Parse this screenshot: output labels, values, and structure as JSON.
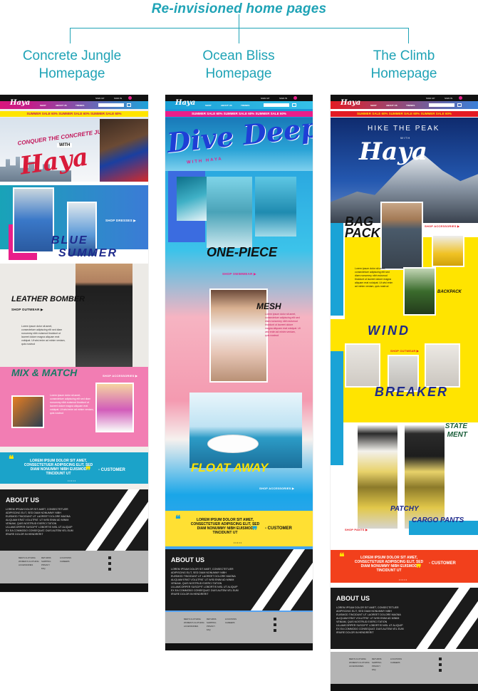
{
  "heading": "Re-invisioned home pages",
  "columns": [
    {
      "title_line1": "Concrete Jungle",
      "title_line2": "Homepage"
    },
    {
      "title_line1": "Ocean Bliss",
      "title_line2": "Homepage"
    },
    {
      "title_line1": "The Climb",
      "title_line2": "Homepage"
    }
  ],
  "common": {
    "brand": "Haya",
    "sign_up": "SIGN UP",
    "sign_in": "SIGN IN",
    "nav": [
      "SHOP",
      "ABOUT US",
      "TRENDS"
    ],
    "sale": "SUMMER SALE 60% SUMMER SALE 60% SUMMER SALE 60%",
    "quote": "LOREM IPSUM DOLOR SIT AMET, CONSECTETUER ADIPISCING ELIT, SED DIAM NONUMMY NIBH EUISMOD TINCIDUNT UT",
    "customer": "- CUSTOMER",
    "about_title": "ABOUT US",
    "about_text": "LOREM IPSUM DOLOR SIT AMET, CONSECTETUER ADIPISCING ELIT, SED DIAM NONUMMY NIBH EUISMOD TINCIDUNT UT LAOREET DOLORE MAGNA ALIQUAM ERAT VOLUTPAT. UT WISI ENIM AD MINIM VENIAM, QUIS NOSTRUD EXERCI TATION ULLAMCORPER SUSCIPIT LOBORTIS NISL UT ALIQUIP EX EA COMMODO CONSEQUAT. DUIS AUTEM VEL EUM IRIURE DOLOR IN HENDRERIT",
    "body_text": "Lorem ipsum dolor sit amet, consectetuer adipiscing elit sed diam nonummy nibh euismod tincidunt ut laoreet dolore magna aliquam erat volutpat. Ut wisi enim ad minim veniam, quis nostrud",
    "footer_col1": [
      "MEN'S CLOTHING",
      "WOMEN'S CLOTHING",
      "ACCESSORIES"
    ],
    "footer_col2": [
      "RETURNS",
      "SHIPPING",
      "PRIVACY",
      "FAQ"
    ],
    "footer_col3": [
      "LOCATIONS",
      "CAREERS"
    ],
    "dots": "•••••"
  },
  "concrete": {
    "hero_line1": "CONQUER THE CONCRETE JUNGLE",
    "hero_with": "WITH",
    "hero_script": "Haya",
    "shop_dresses": "SHOP DRESSES ▶",
    "blue": "BLUE",
    "summer": "SUMMER",
    "bomber": "LEATHER BOMBER",
    "shop_outwear": "SHOP OUTWEAR ▶",
    "mix": "MIX & MATCH",
    "shop_accessories": "SHOP ACCESSORIES ▶"
  },
  "ocean": {
    "hero": "Dive Deep",
    "with": "WITH HAYA",
    "onepiece": "ONE-PIECE",
    "shop_swimwear": "SHOP SWIMWEAR ▶",
    "mesh": "MESH",
    "float": "FLOAT AWAY",
    "shop_accessories": "SHOP ACCESSORIES ▶"
  },
  "climb": {
    "hike": "HIKE THE PEAK",
    "with": "WITH",
    "script": "Haya",
    "bag": "BAG",
    "pack": "PACK",
    "shop_accessories": "SHOP ACCESSORIES ▶",
    "backpack": "BACKPACK",
    "wind": "WIND",
    "shop_outwear": "SHOP OUTWEAR ▶",
    "breaker": "BREAKER",
    "statement": "STATE MENT",
    "patchy": "PATCHY",
    "cargo": "CARGO PANTS",
    "shop_pants": "SHOP PANTS ▶"
  },
  "colors": {
    "teal": "#1fa3b6",
    "pink": "#e91e8a",
    "yellow": "#ffe400",
    "navy": "#1e2a8c",
    "red": "#e31b23"
  }
}
